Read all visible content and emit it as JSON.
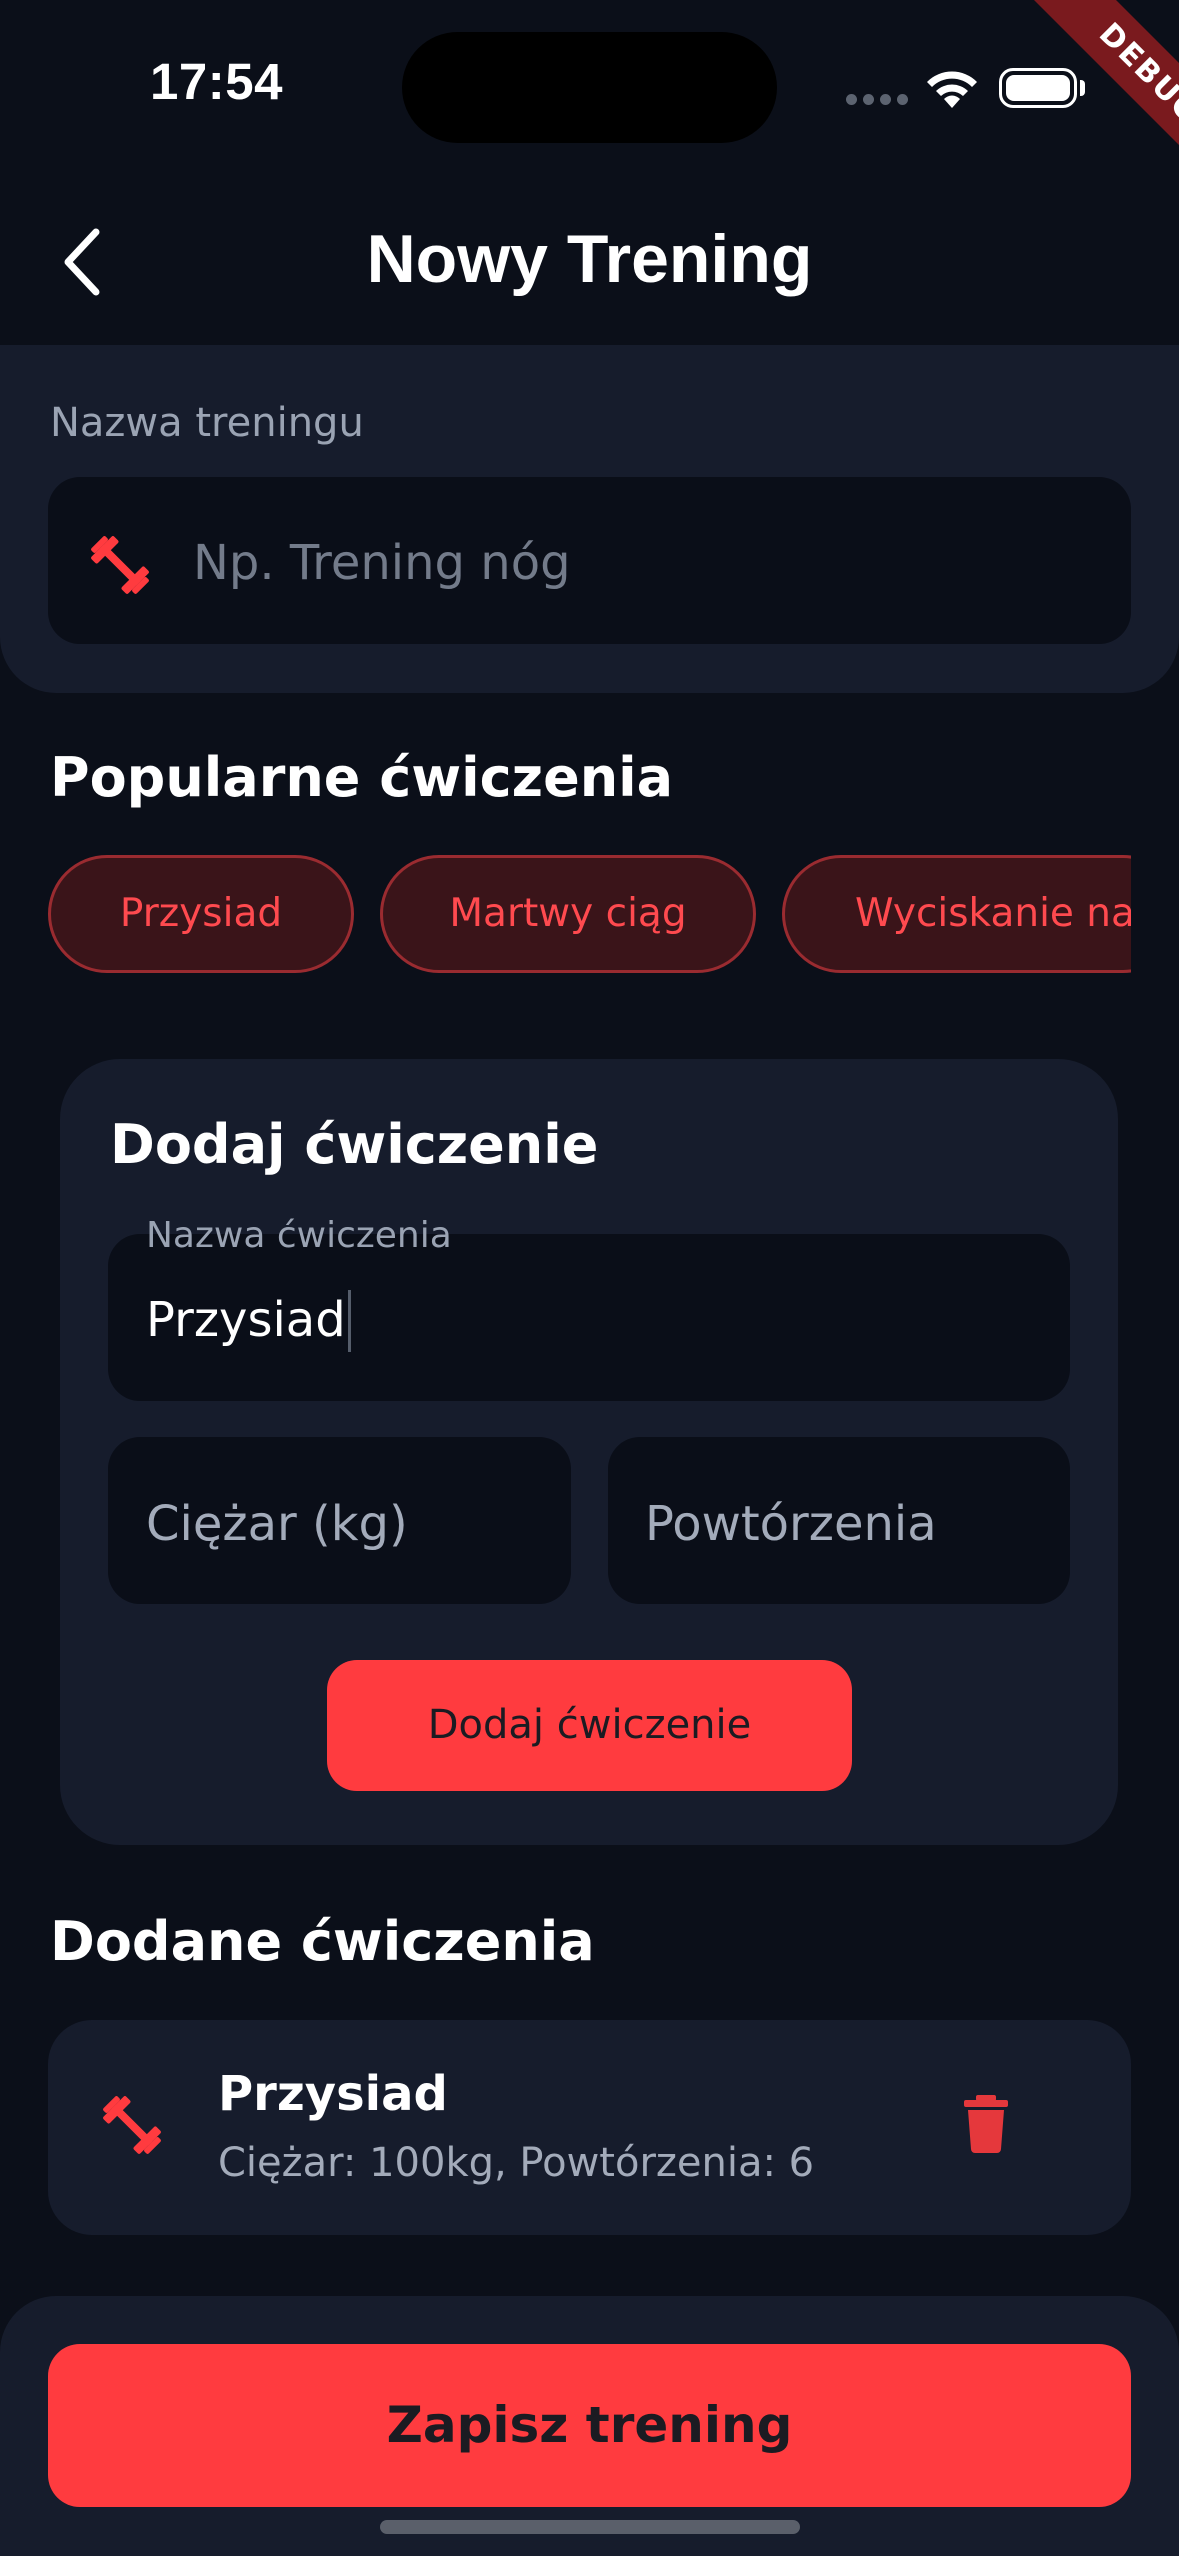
{
  "status_bar": {
    "time": "17:54",
    "debug_label": "DEBUG"
  },
  "app_bar": {
    "back_icon": "chevron-left-icon",
    "title": "Nowy Trening"
  },
  "workout_name": {
    "label": "Nazwa treningu",
    "placeholder": "Np. Trening nóg",
    "icon": "dumbbell-icon"
  },
  "popular": {
    "title": "Popularne ćwiczenia",
    "chips": [
      "Przysiad",
      "Martwy ciąg",
      "Wyciskanie na"
    ]
  },
  "add_exercise": {
    "title": "Dodaj ćwiczenie",
    "name_label": "Nazwa ćwiczenia",
    "name_value": "Przysiad",
    "weight_placeholder": "Ciężar (kg)",
    "reps_placeholder": "Powtórzenia",
    "button_label": "Dodaj ćwiczenie"
  },
  "added": {
    "title": "Dodane ćwiczenia",
    "items": [
      {
        "name": "Przysiad",
        "details": "Ciężar: 100kg, Powtórzenia: 6",
        "icon": "dumbbell-icon",
        "delete_icon": "trash-icon"
      }
    ]
  },
  "save_button": "Zapisz trening",
  "colors": {
    "background": "#0b0f19",
    "surface": "#161c2c",
    "input": "#0a0e18",
    "accent": "#ff3b3f",
    "chip_bg": "#3a1419",
    "chip_border": "#9a2b30"
  }
}
